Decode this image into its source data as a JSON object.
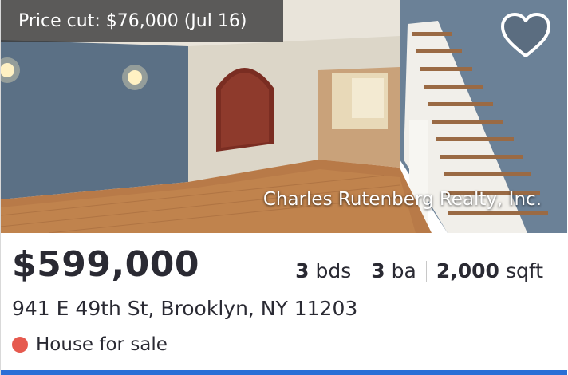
{
  "listing": {
    "price_cut_label": "Price cut: $76,000 (Jul 16)",
    "broker_watermark": "Charles Rutenberg Realty, Inc.",
    "price": "$599,000",
    "beds_value": "3",
    "beds_unit": "bds",
    "baths_value": "3",
    "baths_unit": "ba",
    "sqft_value": "2,000",
    "sqft_unit": "sqft",
    "address": "941 E 49th St, Brooklyn, NY 11203",
    "status": "House for sale",
    "status_color": "#e65a4f",
    "favorite_icon": "heart-outline-icon"
  },
  "colors": {
    "accent_bar": "#2a6fd6",
    "text": "#2a2a33"
  }
}
